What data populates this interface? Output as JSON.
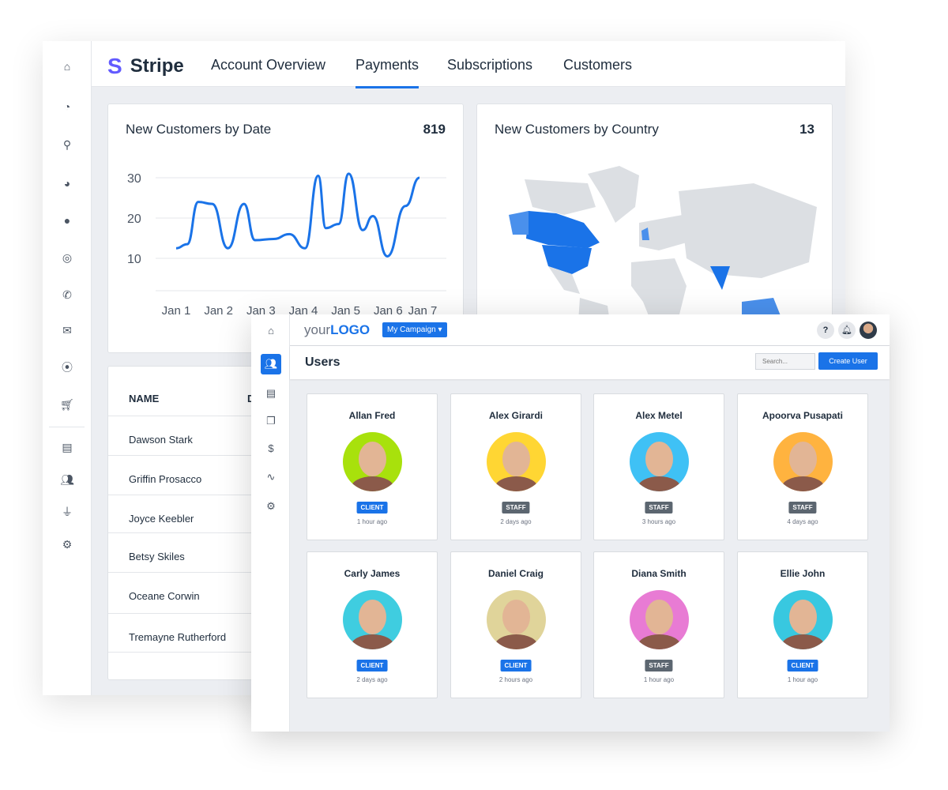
{
  "stripe": {
    "logo_letter": "S",
    "logo": "Stripe",
    "tabs": [
      {
        "label": "Account Overview"
      },
      {
        "label": "Payments",
        "active": true
      },
      {
        "label": "Subscriptions"
      },
      {
        "label": "Customers"
      }
    ],
    "sidebar_icons": [
      "home-icon",
      "dashboard-icon",
      "search-icon",
      "pie-chart-icon",
      "chat-icon",
      "target-icon",
      "phone-icon",
      "mail-icon",
      "location-icon",
      "cart-icon",
      "file-icon",
      "users-icon",
      "plug-icon",
      "gear-icon"
    ],
    "accent": "#1a73e8",
    "new_customers_by_date": {
      "title": "New Customers by Date",
      "total": "819"
    },
    "new_customers_by_country": {
      "title": "New Customers by Country",
      "total": "13",
      "highlight_color": "#1a73e8"
    },
    "table": {
      "headers": [
        "NAME",
        "D"
      ],
      "rows": [
        {
          "name": "Dawson Stark"
        },
        {
          "name": "Griffin Prosacco"
        },
        {
          "name": "Joyce Keebler"
        },
        {
          "name": "Betsy Skiles"
        },
        {
          "name": "Oceane Corwin"
        },
        {
          "name": "Tremayne Rutherford"
        }
      ]
    }
  },
  "chart_data": {
    "type": "line",
    "categories": [
      "Jan 1",
      "Jan 2",
      "Jan 3",
      "Jan 4",
      "Jan 5",
      "Jan 6",
      "Jan 7"
    ],
    "yticks": [
      10,
      20,
      30
    ],
    "ylim": [
      2,
      32
    ],
    "grid": true,
    "color": "#1a73e8",
    "x": [
      0,
      0.26,
      0.52,
      0.85,
      1.22,
      1.6,
      1.86,
      2.3,
      2.67,
      3.04,
      3.35,
      3.53,
      3.83,
      4.07,
      4.4,
      4.64,
      4.98,
      5.41,
      5.74
    ],
    "values": [
      12.5,
      13.5,
      24,
      23.5,
      12.5,
      23.5,
      14.5,
      14.8,
      16,
      12.5,
      30.5,
      17.5,
      18.5,
      31,
      17,
      20.5,
      10.5,
      23,
      30
    ]
  },
  "agency": {
    "logo_light": "your",
    "logo_bold": "LOGO",
    "campaign": "My Campaign",
    "help": "?",
    "page_title": "Users",
    "search_placeholder": "Search...",
    "create_button": "Create User",
    "sidebar_icons": [
      "home-icon",
      "users-icon",
      "report-icon",
      "copy-icon",
      "dollar-icon",
      "activity-icon",
      "gear-icon"
    ],
    "users": [
      {
        "name": "Allan Fred",
        "role": "CLIENT",
        "time": "1 hour ago",
        "bg": "#a8e10c"
      },
      {
        "name": "Alex Girardi",
        "role": "STAFF",
        "time": "2 days ago",
        "bg": "#ffd633"
      },
      {
        "name": "Alex Metel",
        "role": "STAFF",
        "time": "3 hours ago",
        "bg": "#3fc1f5"
      },
      {
        "name": "Apoorva Pusapati",
        "role": "STAFF",
        "time": "4 days ago",
        "bg": "#ffb33f"
      },
      {
        "name": "Carly James",
        "role": "CLIENT",
        "time": "2 days ago",
        "bg": "#3fcde0"
      },
      {
        "name": "Daniel Craig",
        "role": "CLIENT",
        "time": "2 hours ago",
        "bg": "#e0d49a"
      },
      {
        "name": "Diana Smith",
        "role": "STAFF",
        "time": "1 hour ago",
        "bg": "#e87bd4"
      },
      {
        "name": "Ellie John",
        "role": "CLIENT",
        "time": "1 hour ago",
        "bg": "#38c8e0"
      }
    ],
    "client_color": "#1a73e8",
    "staff_color": "#5c6670"
  }
}
